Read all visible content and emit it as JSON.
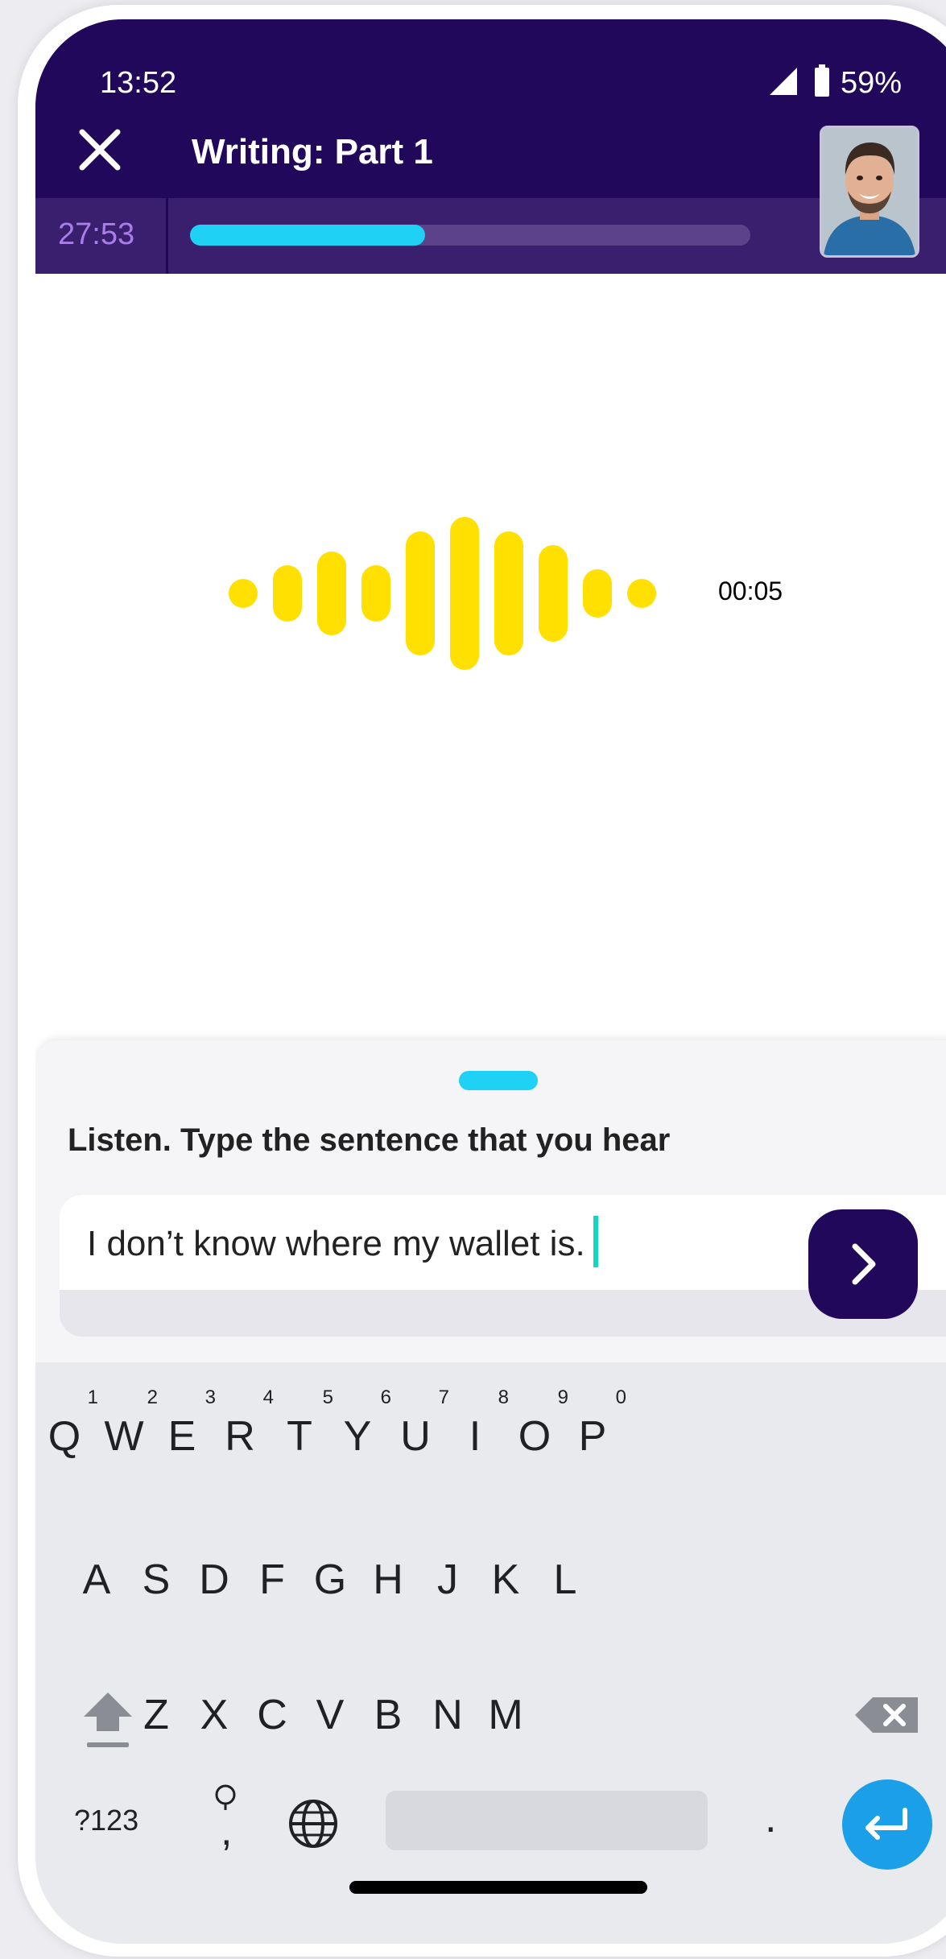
{
  "status_bar": {
    "time": "13:52",
    "battery": "59%"
  },
  "header": {
    "title": "Writing: Part 1",
    "timer": "27:53",
    "progress": 0.42
  },
  "audio": {
    "duration": "00:05"
  },
  "sheet": {
    "instruction": "Listen. Type the sentence that you hear",
    "answer_value": "I don’t know where my wallet is."
  },
  "keyboard": {
    "row1": [
      {
        "k": "Q",
        "h": "1"
      },
      {
        "k": "W",
        "h": "2"
      },
      {
        "k": "E",
        "h": "3"
      },
      {
        "k": "R",
        "h": "4"
      },
      {
        "k": "T",
        "h": "5"
      },
      {
        "k": "Y",
        "h": "6"
      },
      {
        "k": "U",
        "h": "7"
      },
      {
        "k": "I",
        "h": "8"
      },
      {
        "k": "O",
        "h": "9"
      },
      {
        "k": "P",
        "h": "0"
      }
    ],
    "row2": [
      "A",
      "S",
      "D",
      "F",
      "G",
      "H",
      "J",
      "K",
      "L"
    ],
    "row3": [
      "Z",
      "X",
      "C",
      "V",
      "B",
      "N",
      "M"
    ],
    "symbols_key": "?123",
    "comma_key": ",",
    "period_key": "."
  },
  "colors": {
    "header_bg": "#22085a",
    "accent_cyan": "#1fd1f5",
    "waveform": "#ffe000",
    "submit_bg": "#22085a",
    "enter_bg": "#1a9fe8"
  }
}
